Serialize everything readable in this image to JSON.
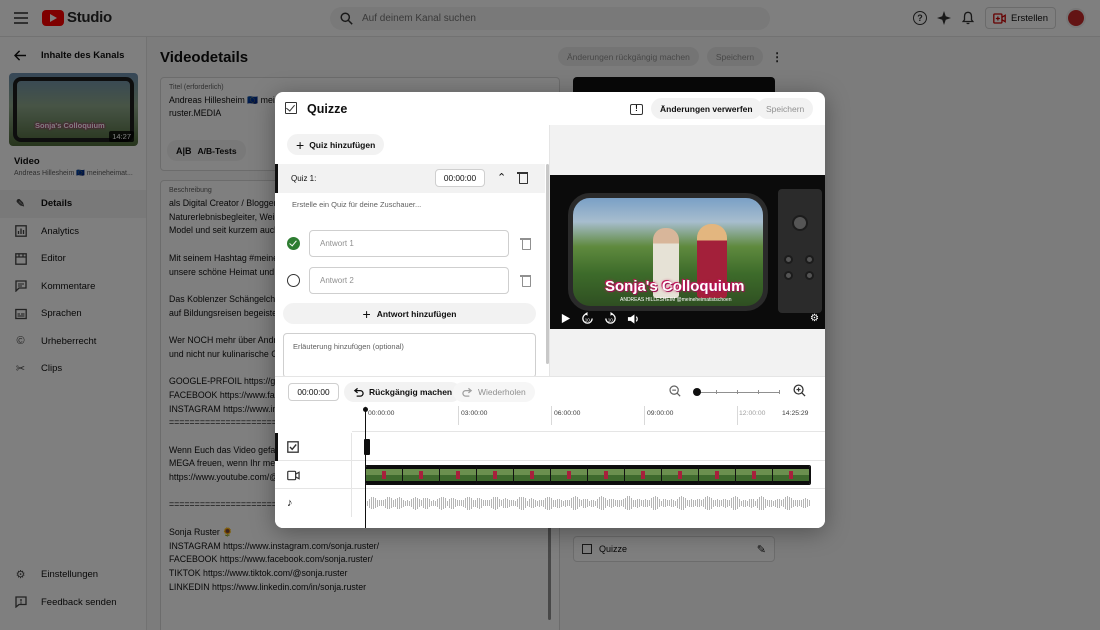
{
  "topbar": {
    "logo_text": "Studio",
    "search_placeholder": "Auf deinem Kanal suchen",
    "create_label": "Erstellen"
  },
  "sidebar": {
    "back_label": "Inhalte des Kanals",
    "thumbnail_title": "Sonja's Colloquium",
    "thumbnail_duration": "14:27",
    "video_label": "Video",
    "channel_text": "Andreas Hillesheim 🇪🇺 meineheimat...",
    "items": [
      {
        "label": "Details",
        "icon": "pencil-icon"
      },
      {
        "label": "Analytics",
        "icon": "analytics-icon"
      },
      {
        "label": "Editor",
        "icon": "editor-icon"
      },
      {
        "label": "Kommentare",
        "icon": "comments-icon"
      },
      {
        "label": "Sprachen",
        "icon": "subtitles-icon"
      },
      {
        "label": "Urheberrecht",
        "icon": "copyright-icon"
      },
      {
        "label": "Clips",
        "icon": "scissors-icon"
      }
    ],
    "bottom_items": [
      {
        "label": "Einstellungen",
        "icon": "gear-icon"
      },
      {
        "label": "Feedback senden",
        "icon": "feedback-icon"
      }
    ]
  },
  "details": {
    "page_title": "Videodetails",
    "undo_changes_label": "Änderungen rückgängig machen",
    "save_label": "Speichern",
    "title_label": "Titel (erforderlich)",
    "title_value_line1": "Andreas Hillesheim 🇪🇺 meine",
    "title_value_line2": "ruster.MEDIA",
    "ab_test_label": "A/B-Tests",
    "description_label": "Beschreibung",
    "description_lines": [
      "als Digital Creator / Blogger,",
      "Naturerlebnisbegleiter, Weinl",
      "Model und seit kurzem auch",
      "",
      "Mit seinem Hashtag #meine",
      "unsere schöne Heimat und z",
      "",
      "Das Koblenzer Schängelche",
      "auf Bildungsreisen begeister",
      "",
      "Wer NOCH mehr über Andre",
      "und nicht nur kulinarische Ge",
      "",
      "GOOGLE-PRFOIL https://g.co",
      "FACEBOOK https://www.face",
      "INSTAGRAM https://www.ins",
      "==========================",
      "",
      "Wenn Euch das Video gefall",
      "MEGA freuen, wenn Ihr mein",
      "https://www.youtube.com/@",
      "",
      "==========================",
      "",
      "Sonja Ruster 🌻",
      "INSTAGRAM https://www.instagram.com/sonja.ruster/",
      "FACEBOOK https://www.facebook.com/sonja.ruster/",
      "TIKTOK https://www.tiktok.com/@sonja.ruster",
      "LINKEDIN https://www.linkedin.com/in/sonja.ruster"
    ],
    "quiz_card_label": "Quizze"
  },
  "dialog": {
    "title": "Quizze",
    "discard_label": "Änderungen verwerfen",
    "save_label": "Speichern",
    "add_quiz_label": "Quiz hinzufügen",
    "quiz_row_label": "Quiz 1:",
    "quiz_time": "00:00:00",
    "question_placeholder": "Erstelle ein Quiz für deine Zuschauer...",
    "answers": [
      {
        "placeholder": "Antwort 1",
        "correct": true
      },
      {
        "placeholder": "Antwort 2",
        "correct": false
      }
    ],
    "add_answer_label": "Antwort hinzufügen",
    "explanation_placeholder": "Erläuterung hinzufügen (optional)",
    "video": {
      "title": "Sonja's Colloquium",
      "subtitle": "ANDREAS HILLESHEIM @meineheimatistschoen",
      "controls": [
        "play-icon",
        "rewind-10-icon",
        "forward-10-icon",
        "volume-icon",
        "gear-icon"
      ]
    }
  },
  "timeline": {
    "current_time": "00:00:00",
    "undo_label": "Rückgängig machen",
    "redo_label": "Wiederholen",
    "ruler_labels": [
      "00:00:00",
      "03:00:00",
      "06:00:00",
      "09:00:00",
      "12:00:00",
      "14:25:29"
    ],
    "tracks": [
      "quiz-track-icon",
      "video-track-icon",
      "audio-track-icon"
    ],
    "frame_count": 12
  }
}
